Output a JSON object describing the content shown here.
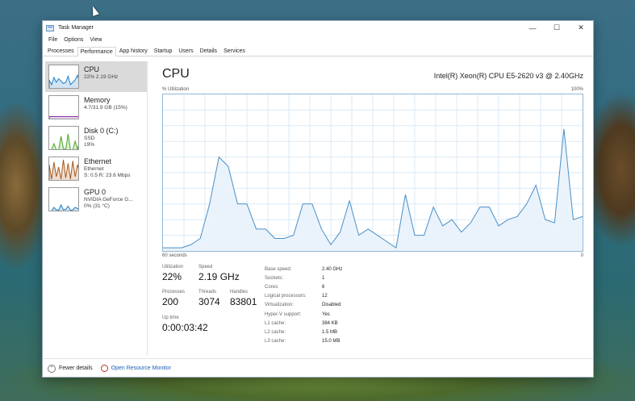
{
  "window": {
    "title": "Task Manager",
    "controls": {
      "minimize": "—",
      "maximize": "☐",
      "close": "✕"
    }
  },
  "menu": [
    "File",
    "Options",
    "View"
  ],
  "tabs": [
    "Processes",
    "Performance",
    "App history",
    "Startup",
    "Users",
    "Details",
    "Services"
  ],
  "active_tab": "Performance",
  "sidebar": {
    "items": [
      {
        "title": "CPU",
        "sub1": "22% 2.19 GHz",
        "sub2": "",
        "sub3": "",
        "color": "#1f7fc6"
      },
      {
        "title": "Memory",
        "sub1": "4.7/31.9 GB (15%)",
        "sub2": "",
        "sub3": "",
        "color": "#8b2fa8"
      },
      {
        "title": "Disk 0 (C:)",
        "sub1": "SSD",
        "sub2": "19%",
        "sub3": "",
        "color": "#4da523"
      },
      {
        "title": "Ethernet",
        "sub1": "Ethernet",
        "sub2": "S: 0.5 R: 23.6 Mbps",
        "sub3": "",
        "color": "#a8591e"
      },
      {
        "title": "GPU 0",
        "sub1": "NVIDIA GeForce G...",
        "sub2": "0% (31 °C)",
        "sub3": "",
        "color": "#1f7fc6"
      }
    ]
  },
  "main": {
    "title": "CPU",
    "model": "Intel(R) Xeon(R) CPU E5-2620 v3 @ 2.40GHz",
    "util_label": "% Utilization",
    "util_max": "100%",
    "axis_left": "60 seconds",
    "axis_right": "0",
    "graph_values": [
      2,
      2,
      2,
      4,
      8,
      30,
      60,
      54,
      30,
      30,
      14,
      14,
      8,
      8,
      10,
      30,
      30,
      14,
      4,
      12,
      32,
      10,
      14,
      10,
      6,
      2,
      36,
      10,
      10,
      28,
      16,
      20,
      12,
      18,
      28,
      28,
      16,
      20,
      22,
      30,
      42,
      20,
      18,
      78,
      20,
      22
    ]
  },
  "stats": {
    "utilization": {
      "label": "Utilization",
      "value": "22%"
    },
    "speed": {
      "label": "Speed",
      "value": "2.19 GHz"
    },
    "processes": {
      "label": "Processes",
      "value": "200"
    },
    "threads": {
      "label": "Threads",
      "value": "3074"
    },
    "handles": {
      "label": "Handles",
      "value": "83801"
    },
    "uptime": {
      "label": "Up time",
      "value": "0:00:03:42"
    }
  },
  "specs": [
    {
      "k": "Base speed:",
      "v": "2.40 GHz"
    },
    {
      "k": "Sockets:",
      "v": "1"
    },
    {
      "k": "Cores:",
      "v": "6"
    },
    {
      "k": "Logical processors:",
      "v": "12"
    },
    {
      "k": "Virtualization:",
      "v": "Disabled"
    },
    {
      "k": "Hyper-V support:",
      "v": "Yes"
    },
    {
      "k": "L1 cache:",
      "v": "384 KB"
    },
    {
      "k": "L2 cache:",
      "v": "1.5 MB"
    },
    {
      "k": "L3 cache:",
      "v": "15.0 MB"
    }
  ],
  "footer": {
    "fewer_details": "Fewer details",
    "resource_monitor": "Open Resource Monitor"
  }
}
